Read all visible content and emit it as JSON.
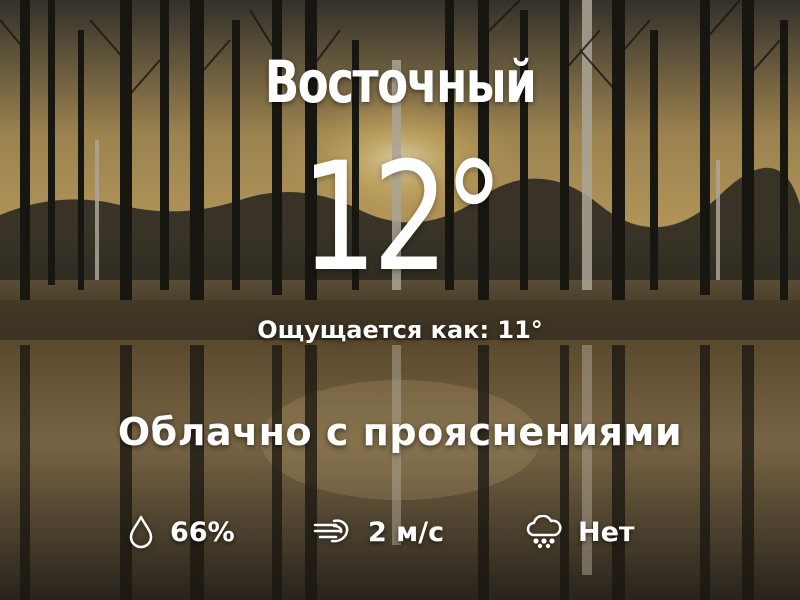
{
  "location": {
    "city": "Восточный"
  },
  "current": {
    "temperature": "12°",
    "feels_like": "Ощущается как: 11°",
    "condition": "Облачно с прояснениями"
  },
  "details": {
    "humidity": {
      "icon": "water-drop-icon",
      "value": "66%"
    },
    "wind": {
      "icon": "wind-icon",
      "value": "2 м/с"
    },
    "precipitation": {
      "icon": "rain-cloud-icon",
      "value": "Нет"
    }
  },
  "colors": {
    "text": "#ffffff",
    "sky_glow": "#d8b56a",
    "dark_trees": "#1e1a12",
    "water": "#3a3426"
  }
}
